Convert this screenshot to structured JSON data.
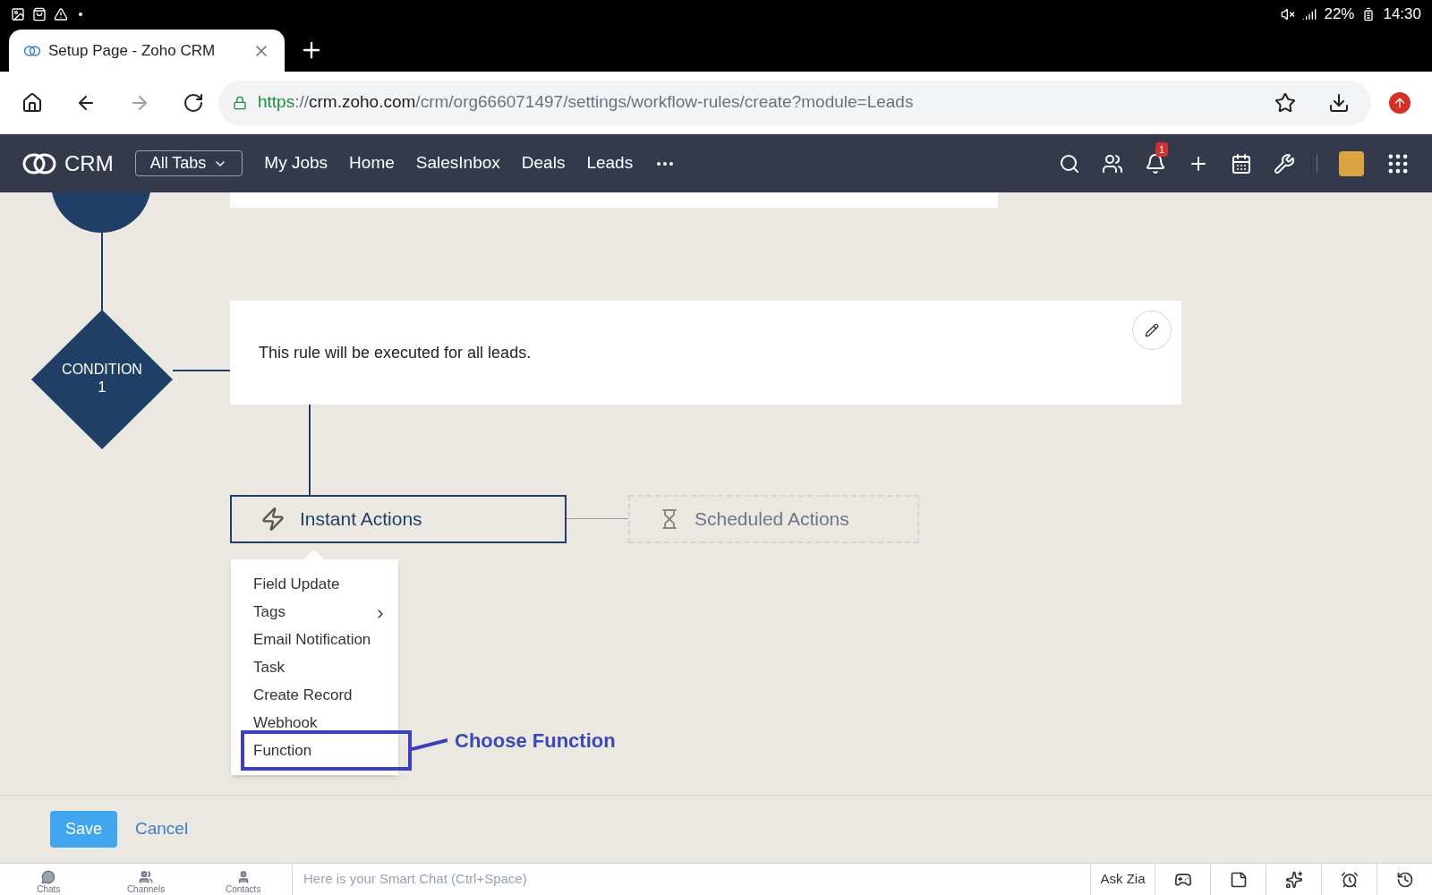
{
  "status_bar": {
    "battery": "22%",
    "time": "14:30"
  },
  "browser": {
    "tab_title": "Setup Page - Zoho CRM",
    "url": {
      "scheme": "https",
      "separator": "://",
      "host": "crm.zoho.com",
      "path": "/crm/org666071497/settings/workflow-rules/create?module=Leads"
    }
  },
  "nav": {
    "logo": "CRM",
    "all_tabs": "All Tabs",
    "items": [
      "My Jobs",
      "Home",
      "SalesInbox",
      "Deals",
      "Leads"
    ],
    "notification_count": "1"
  },
  "workflow": {
    "condition": {
      "label": "CONDITION",
      "number": "1",
      "text": "This rule will be executed for all leads."
    },
    "instant_actions": "Instant Actions",
    "scheduled_actions": "Scheduled Actions",
    "menu": [
      {
        "label": "Field Update",
        "submenu": false,
        "annotated": false
      },
      {
        "label": "Tags",
        "submenu": true,
        "annotated": false
      },
      {
        "label": "Email Notification",
        "submenu": false,
        "annotated": false
      },
      {
        "label": "Task",
        "submenu": false,
        "annotated": false
      },
      {
        "label": "Create Record",
        "submenu": false,
        "annotated": false
      },
      {
        "label": "Webhook",
        "submenu": false,
        "annotated": false
      },
      {
        "label": "Function",
        "submenu": false,
        "annotated": true
      }
    ],
    "annotation": "Choose Function"
  },
  "footer": {
    "save": "Save",
    "cancel": "Cancel"
  },
  "chat_bar": {
    "tabs": [
      {
        "label": "Chats",
        "kind": "chat"
      },
      {
        "label": "Channels",
        "kind": "channels"
      },
      {
        "label": "Contacts",
        "kind": "contact"
      }
    ],
    "placeholder": "Here is your Smart Chat (Ctrl+Space)",
    "ask_zia": "Ask Zia"
  }
}
